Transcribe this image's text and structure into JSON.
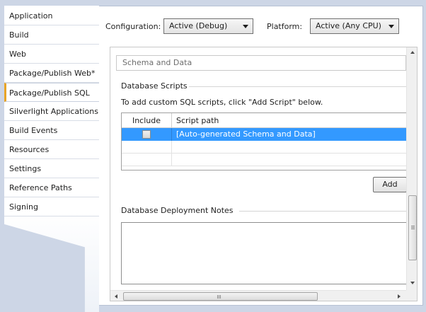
{
  "sidebar": {
    "tabs": [
      {
        "label": "Application"
      },
      {
        "label": "Build"
      },
      {
        "label": "Web"
      },
      {
        "label": "Package/Publish Web*"
      },
      {
        "label": "Package/Publish SQL"
      },
      {
        "label": "Silverlight Applications"
      },
      {
        "label": "Build Events"
      },
      {
        "label": "Resources"
      },
      {
        "label": "Settings"
      },
      {
        "label": "Reference Paths"
      },
      {
        "label": "Signing"
      }
    ],
    "active_tab": "Package/Publish SQL",
    "accent_color": "#e8a427"
  },
  "config_bar": {
    "configuration_label": "Configuration:",
    "configuration_value": "Active (Debug)",
    "platform_label": "Platform:",
    "platform_value": "Active (Any CPU)"
  },
  "content": {
    "section_header": "Schema and Data",
    "database_scripts": {
      "title": "Database Scripts",
      "instructions": "To add custom SQL scripts, click \"Add Script\" below.",
      "grid": {
        "columns": [
          "Include",
          "Script path"
        ],
        "rows": [
          {
            "include": false,
            "script_path": "[Auto-generated Schema and Data]",
            "selected": true
          }
        ]
      },
      "add_button_label": "Add"
    },
    "deployment_notes": {
      "title": "Database Deployment Notes",
      "value": ""
    }
  },
  "colors": {
    "selection": "#3399ff",
    "background": "#cdd6e6"
  },
  "icons": {
    "scroll_up": "triangle-up-icon",
    "scroll_down": "triangle-down-icon",
    "scroll_left": "triangle-left-icon",
    "scroll_right": "triangle-right-icon",
    "dropdown": "chevron-down-icon"
  }
}
